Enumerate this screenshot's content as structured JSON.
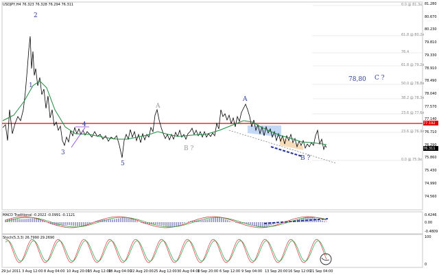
{
  "header": {
    "symbol_text": "USDJPY,H4  76.323 76.328 76.294 76.311"
  },
  "price_axis": {
    "ticks": [
      "81.280",
      "80.670",
      "80.230",
      "79.810",
      "79.330",
      "78.910",
      "78.490",
      "78.040",
      "77.570",
      "77.140",
      "76.710",
      "76.290",
      "75.860",
      "75.430",
      "74.990",
      "74.560"
    ],
    "current_price": "76.311",
    "red_line_label": "77.192"
  },
  "macd_panel": {
    "label": "MACD Traditional -0.2022 -0.0991 -0.1121",
    "ticks": [
      "0.4246",
      "0.00",
      "-0.4809"
    ]
  },
  "stoch_panel": {
    "label": "Stoch(5,3,3) 26.7990 29.2690",
    "ticks": [
      "100",
      "0"
    ]
  },
  "time_axis": {
    "labels": [
      "29 Jul 2011",
      "3 Aug 12:00",
      "8 Aug 04:00",
      "10 Aug 20:00",
      "15 Aug 12:00",
      "18 Aug 04:00",
      "22 Aug 20:00",
      "25 Aug 12:00",
      "30 Aug 04:00",
      "1 Sep 20:00",
      "6 Sep 12:00",
      "9 Sep 04:00",
      "13 Sep 20:00",
      "16 Sep 12:00",
      "21 Sep 04:00"
    ]
  },
  "fib_levels": [
    "0.0 @ 81.3x",
    "61.8 @ 80.2x",
    "76.4",
    "61.8 @ 79.2x",
    "50.0 @ 78.8x",
    "38.2 @ 78.3x",
    "23.6 @ 77.6x",
    "23.6 @ 76.9x",
    "0.0 @ 75.9x"
  ],
  "annotations": {
    "wave_2": "2",
    "wave_1": "1",
    "wave_3": "3",
    "wave_4": "4",
    "wave_5": "5",
    "wave_A_small": "A",
    "wave_B_small": "B ?",
    "wave_A": "A",
    "wave_B": "B ?",
    "target_value": "78,80",
    "wave_C": "C ?"
  },
  "colors": {
    "red_line": "#e00000",
    "price_line": "#000000",
    "ma_line": "#1a8a3a",
    "annotation_blue": "#2d3a9e",
    "macd_red": "#d02020",
    "macd_green": "#2a9a2a",
    "stoch_red": "#e03030",
    "stoch_green": "#20a040",
    "shade_blue": "#aac8ef",
    "shade_orange": "#f5d3a8"
  }
}
